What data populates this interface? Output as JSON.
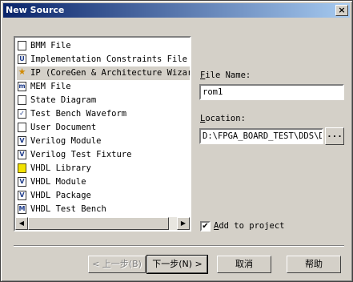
{
  "window": {
    "title": "New Source",
    "close_glyph": "×"
  },
  "source_types": [
    {
      "label": "BMM File",
      "icon": "file-icon",
      "glyph": ""
    },
    {
      "label": "Implementation Constraints File",
      "icon": "constraints-file-icon",
      "glyph": "U"
    },
    {
      "label": "IP (CoreGen & Architecture Wizard)",
      "icon": "ip-icon",
      "glyph": "★"
    },
    {
      "label": "MEM File",
      "icon": "mem-file-icon",
      "glyph": "m"
    },
    {
      "label": "State Diagram",
      "icon": "state-diagram-icon",
      "glyph": ""
    },
    {
      "label": "Test Bench Waveform",
      "icon": "waveform-icon",
      "glyph": "✓"
    },
    {
      "label": "User Document",
      "icon": "document-icon",
      "glyph": ""
    },
    {
      "label": "Verilog Module",
      "icon": "verilog-module-icon",
      "glyph": "V"
    },
    {
      "label": "Verilog Test Fixture",
      "icon": "verilog-test-icon",
      "glyph": "V"
    },
    {
      "label": "VHDL Library",
      "icon": "folder-icon",
      "glyph": ""
    },
    {
      "label": "VHDL Module",
      "icon": "vhdl-module-icon",
      "glyph": "V"
    },
    {
      "label": "VHDL Package",
      "icon": "vhdl-package-icon",
      "glyph": "V"
    },
    {
      "label": "VHDL Test Bench",
      "icon": "vhdl-test-icon",
      "glyph": "M"
    }
  ],
  "selected_index": 2,
  "file_name": {
    "label_prefix": "F",
    "label_rest": "ile Name:",
    "value": "rom1"
  },
  "location": {
    "label_prefix": "L",
    "label_rest": "ocation:",
    "value": "D:\\FPGA_BOARD_TEST\\DDS\\DD",
    "browse_label": "..."
  },
  "add_to_project": {
    "label_prefix": "A",
    "label_rest": "dd to project",
    "checked": true,
    "check_glyph": "✔"
  },
  "buttons": {
    "back": "< 上一步(B)",
    "next": "下一步(N) >",
    "cancel": "取消",
    "help": "帮助"
  },
  "scroll": {
    "left_glyph": "◀",
    "right_glyph": "▶"
  }
}
